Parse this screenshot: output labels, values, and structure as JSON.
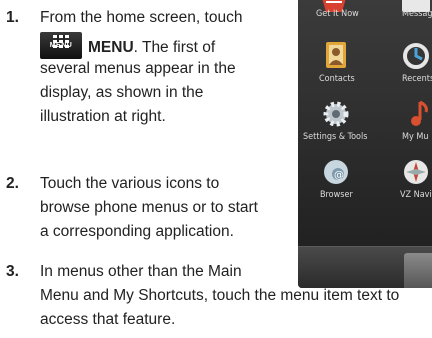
{
  "steps": [
    {
      "number": "1.",
      "pre": "From the home screen, touch",
      "key_label": "MENU",
      "bold": "MENU",
      "post": ". The first of",
      "lines": [
        "several menus appear in the",
        "display, as shown in the",
        "illustration at right."
      ]
    },
    {
      "number": "2.",
      "lines": [
        "Touch the various icons to",
        "browse phone menus or to start",
        "a corresponding application."
      ]
    },
    {
      "number": "3.",
      "lines": [
        "In menus other than the Main",
        "Menu and My Shortcuts, touch the menu item text to",
        "access that feature."
      ]
    }
  ],
  "phone": {
    "items": [
      {
        "label": "Get It Now",
        "icon": "get-it-now-icon"
      },
      {
        "label": "Messag",
        "icon": "messaging-icon"
      },
      {
        "label": "Contacts",
        "icon": "contacts-icon"
      },
      {
        "label": "Recents",
        "icon": "recents-icon"
      },
      {
        "label": "Settings & Tools",
        "icon": "settings-gear-icon"
      },
      {
        "label": "My Mu",
        "icon": "music-note-icon"
      },
      {
        "label": "Browser",
        "icon": "browser-globe-icon"
      },
      {
        "label": "VZ Navi",
        "icon": "navigator-compass-icon"
      }
    ]
  }
}
